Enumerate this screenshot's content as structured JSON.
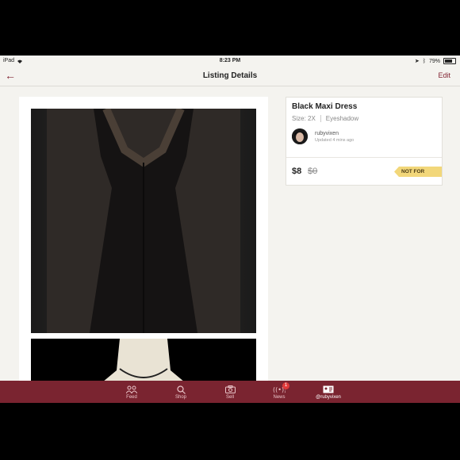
{
  "status": {
    "device": "iPad",
    "time": "8:23 PM",
    "battery": "79%"
  },
  "nav": {
    "title": "Listing Details",
    "edit": "Edit"
  },
  "listing": {
    "title": "Black Maxi Dress",
    "size": "Size: 2X",
    "brand": "Eyeshadow",
    "seller": "rubyvixen",
    "updated": "Updated 4 mins ago",
    "price": "$8",
    "original_price": "$0",
    "badge": "NOT FOR SALE"
  },
  "tabs": [
    {
      "label": "Feed",
      "icon": "people-icon"
    },
    {
      "label": "Shop",
      "icon": "search-icon"
    },
    {
      "label": "Sell",
      "icon": "camera-icon"
    },
    {
      "label": "News",
      "icon": "broadcast-icon",
      "badge": "1"
    },
    {
      "label": "@rubyvixen",
      "icon": "profile-card-icon"
    }
  ],
  "colors": {
    "accent": "#822432",
    "tabbar": "#7a2430",
    "badge": "#f2d77a"
  }
}
